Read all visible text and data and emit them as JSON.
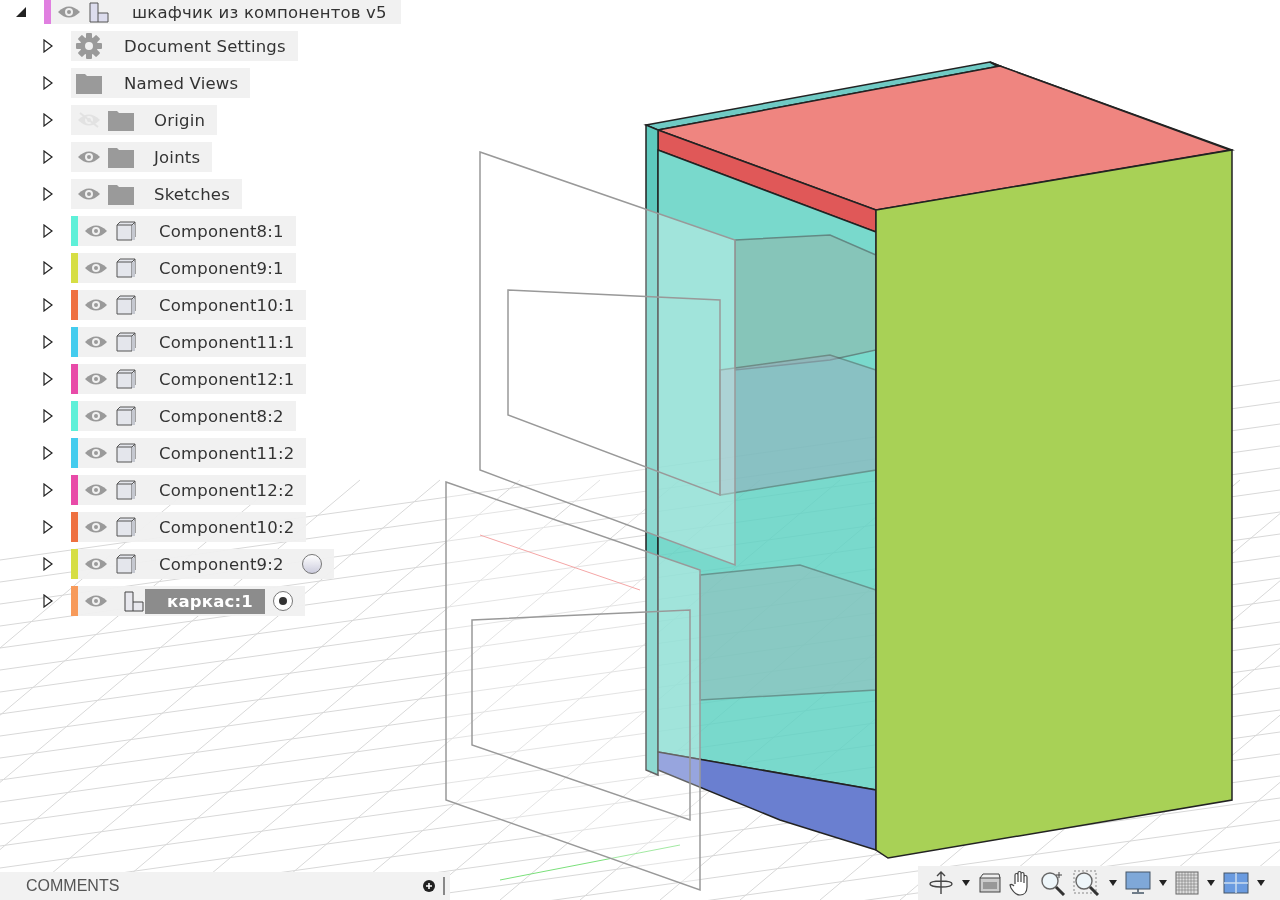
{
  "browser": {
    "root": {
      "name": "шкафчик из компонентов v5",
      "color": "#e07fe0",
      "visible": true,
      "expanded": true,
      "kind": "assembly",
      "children": [
        {
          "kind": "settings",
          "name": "Document Settings",
          "expanded": false
        },
        {
          "kind": "folder",
          "name": "Named Views",
          "expanded": false
        },
        {
          "kind": "folder",
          "name": "Origin",
          "visible": false,
          "expanded": false
        },
        {
          "kind": "folder",
          "name": "Joints",
          "visible": true,
          "expanded": false
        },
        {
          "kind": "folder",
          "name": "Sketches",
          "visible": true,
          "expanded": false
        },
        {
          "kind": "component",
          "name": "Component8:1",
          "color": "#5ef0d8",
          "visible": true,
          "expanded": false
        },
        {
          "kind": "component",
          "name": "Component9:1",
          "color": "#d6de44",
          "visible": true,
          "expanded": false
        },
        {
          "kind": "component",
          "name": "Component10:1",
          "color": "#ee7040",
          "visible": true,
          "expanded": false
        },
        {
          "kind": "component",
          "name": "Component11:1",
          "color": "#44ccee",
          "visible": true,
          "expanded": false
        },
        {
          "kind": "component",
          "name": "Component12:1",
          "color": "#e84aa8",
          "visible": true,
          "expanded": false
        },
        {
          "kind": "component",
          "name": "Component8:2",
          "color": "#5ef0d8",
          "visible": true,
          "expanded": false
        },
        {
          "kind": "component",
          "name": "Component11:2",
          "color": "#44ccee",
          "visible": true,
          "expanded": false
        },
        {
          "kind": "component",
          "name": "Component12:2",
          "color": "#e84aa8",
          "visible": true,
          "expanded": false
        },
        {
          "kind": "component",
          "name": "Component10:2",
          "color": "#ee7040",
          "visible": true,
          "expanded": false
        },
        {
          "kind": "component",
          "name": "Component9:2",
          "color": "#d6de44",
          "visible": true,
          "expanded": false,
          "activation": {
            "selected": false
          }
        },
        {
          "kind": "assembly",
          "name": "каркас:1",
          "color": "#f79a5a",
          "visible": true,
          "expanded": false,
          "activation": {
            "selected": true
          }
        }
      ]
    }
  },
  "comments": {
    "title": "COMMENTS"
  }
}
